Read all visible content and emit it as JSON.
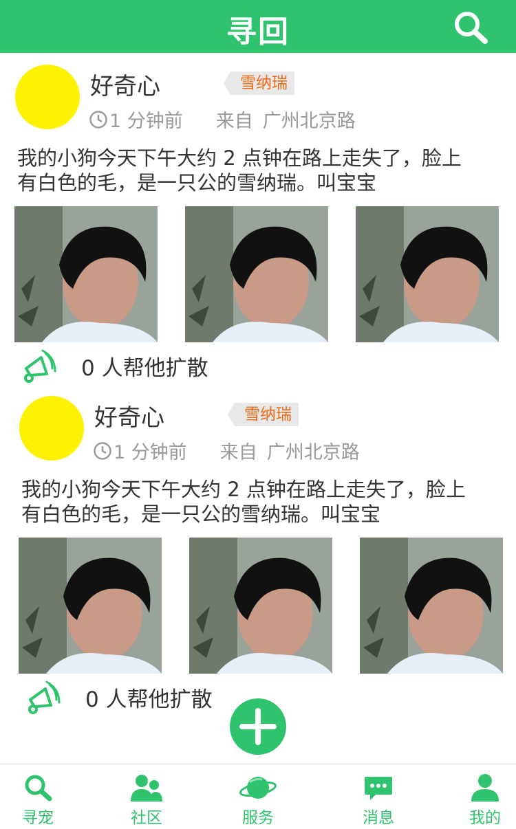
{
  "header": {
    "title": "寻回"
  },
  "posts": [
    {
      "username": "好奇心",
      "tag": "雪纳瑞",
      "time": "1 分钟前",
      "from_label": "来自",
      "location": "广州北京路",
      "text_line1": "我的小狗今天下午大约 2 点钟在路上走失了，脸上",
      "text_line2": "有白色的毛，是一只公的雪纳瑞。叫宝宝",
      "share_text": "0 人帮他扩散"
    },
    {
      "username": "好奇心",
      "tag": "雪纳瑞",
      "time": "1 分钟前",
      "from_label": "来自",
      "location": "广州北京路",
      "text_line1": "我的小狗今天下午大约 2 点钟在路上走失了，脸上",
      "text_line2": "有白色的毛，是一只公的雪纳瑞。叫宝宝",
      "share_text": "0 人帮他扩散"
    }
  ],
  "tabbar": {
    "items": [
      {
        "label": "寻宠",
        "icon": "search-icon"
      },
      {
        "label": "社区",
        "icon": "community-icon"
      },
      {
        "label": "服务",
        "icon": "planet-icon"
      },
      {
        "label": "消息",
        "icon": "message-icon"
      },
      {
        "label": "我的",
        "icon": "person-icon"
      }
    ]
  },
  "colors": {
    "brand": "#2ec36c",
    "tag_text": "#f06a14",
    "avatar": "#fff200"
  }
}
